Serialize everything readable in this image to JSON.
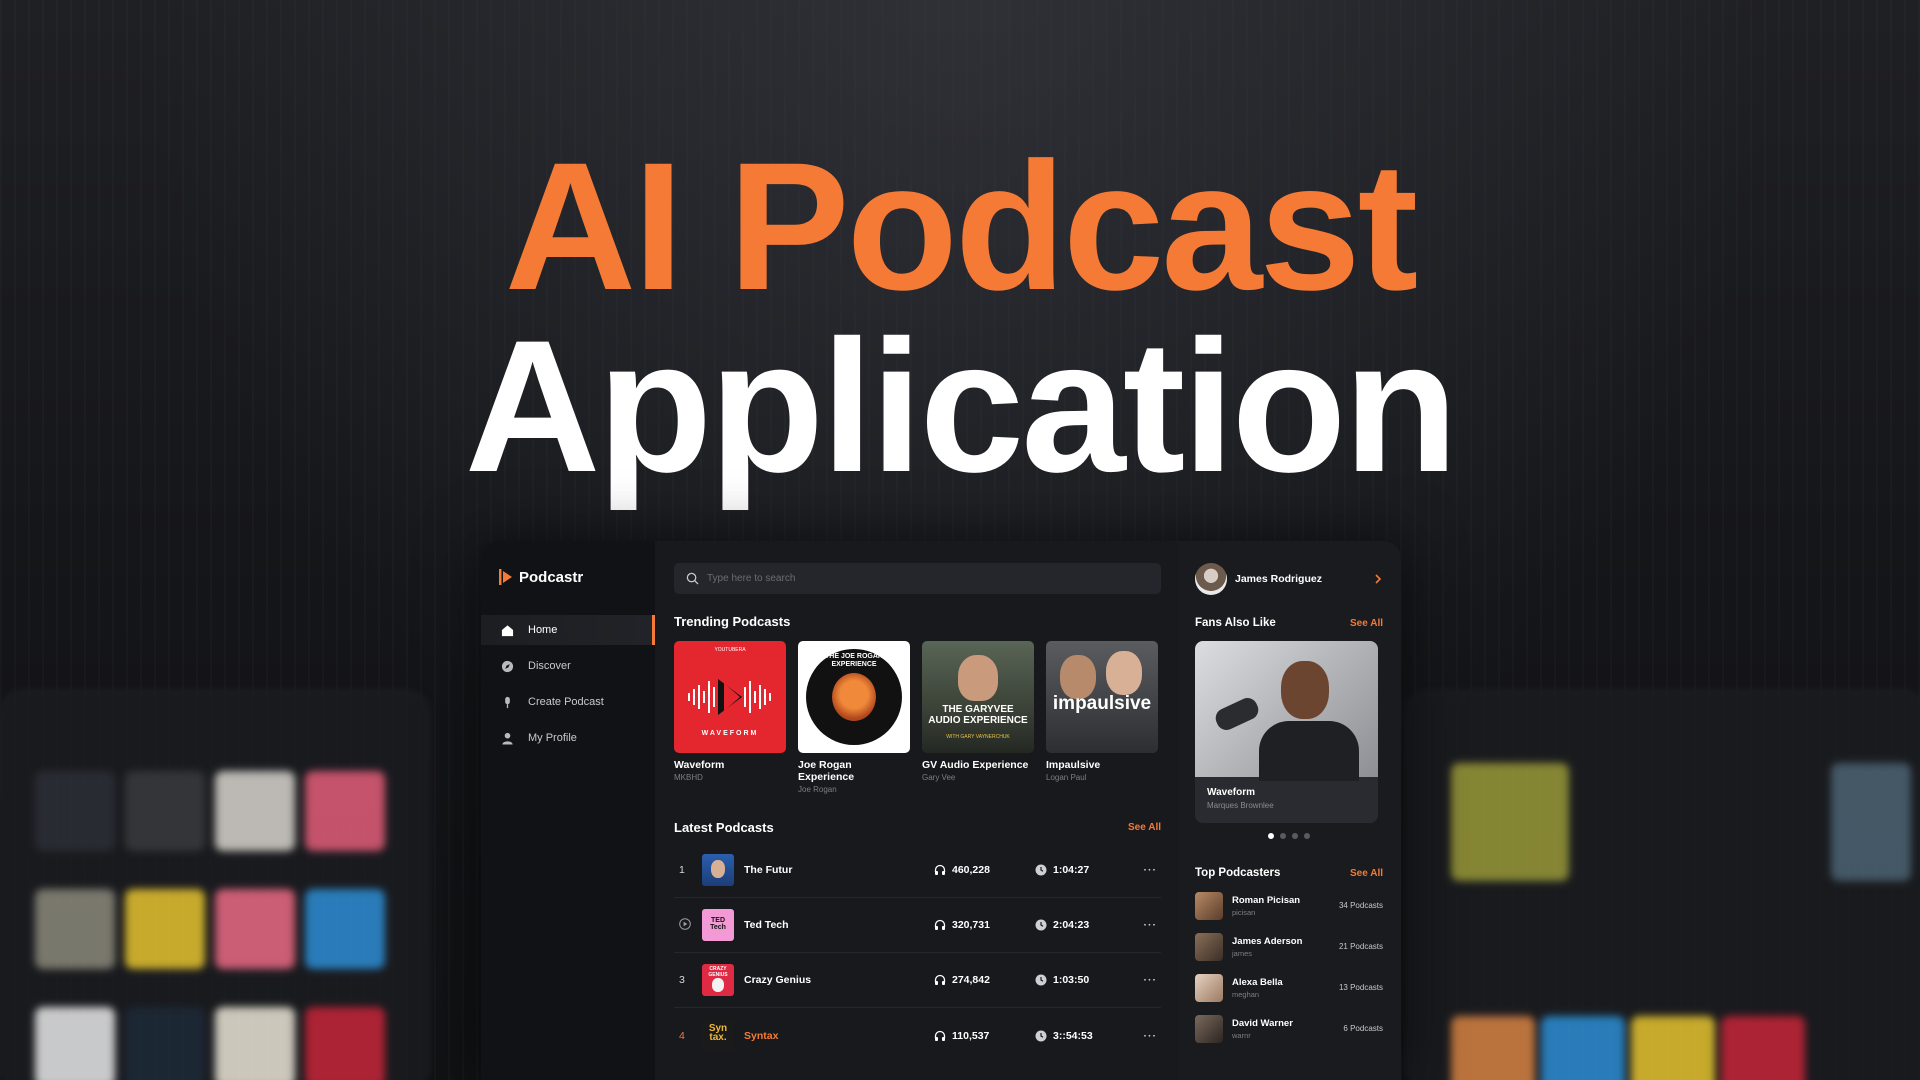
{
  "hero": {
    "line1": "AI Podcast",
    "line2": "Application"
  },
  "app": {
    "brand": "Podcastr",
    "nav": [
      {
        "label": "Home",
        "icon": "home-icon",
        "active": true
      },
      {
        "label": "Discover",
        "icon": "compass-icon",
        "active": false
      },
      {
        "label": "Create Podcast",
        "icon": "microphone-icon",
        "active": false
      },
      {
        "label": "My Profile",
        "icon": "user-icon",
        "active": false
      }
    ],
    "search": {
      "placeholder": "Type here to search"
    },
    "trending": {
      "title": "Trending Podcasts",
      "items": [
        {
          "title": "Waveform",
          "author": "MKBHD",
          "cover_text": "WAVEFORM",
          "cover_top": "YOUTUBERA"
        },
        {
          "title": "Joe Rogan Experience",
          "author": "Joe Rogan",
          "cover_text": "THE JOE ROGAN EXPERIENCE"
        },
        {
          "title": "GV Audio Experience",
          "author": "Gary Vee",
          "cover_text": "THE GARYVEE AUDIO EXPERIENCE",
          "cover_sub": "WITH GARY VAYNERCHUK"
        },
        {
          "title": "Impaulsive",
          "author": "Logan Paul",
          "cover_text": "impaulsive"
        }
      ]
    },
    "latest": {
      "title": "Latest Podcasts",
      "see_all": "See All",
      "rows": [
        {
          "num": "1",
          "name": "The Futur",
          "listeners": "460,228",
          "duration": "1:04:27",
          "more": "···"
        },
        {
          "num": "",
          "name": "Ted Tech",
          "listeners": "320,731",
          "duration": "2:04:23",
          "more": "···",
          "playing_icon": "play-circle-icon",
          "thumb_text": "TED Tech"
        },
        {
          "num": "3",
          "name": "Crazy Genius",
          "listeners": "274,842",
          "duration": "1:03:50",
          "more": "···",
          "thumb_text": "CRAZY GENIUS"
        },
        {
          "num": "4",
          "name": "Syntax",
          "listeners": "110,537",
          "duration": "3::54:53",
          "more": "···",
          "thumb_text": "Syn tax."
        }
      ]
    },
    "user": {
      "name": "James Rodriguez"
    },
    "fans": {
      "title": "Fans Also Like",
      "see_all": "See All",
      "card": {
        "title": "Waveform",
        "author": "Marques Brownlee"
      }
    },
    "top_podcasters": {
      "title": "Top Podcasters",
      "see_all": "See All",
      "items": [
        {
          "name": "Roman Picisan",
          "handle": "picisan",
          "count": "34 Podcasts"
        },
        {
          "name": "James Aderson",
          "handle": "james",
          "count": "21 Podcasts"
        },
        {
          "name": "Alexa Bella",
          "handle": "meghan",
          "count": "13 Podcasts"
        },
        {
          "name": "David Warner",
          "handle": "warnr",
          "count": "6 Podcasts"
        }
      ]
    }
  },
  "colors": {
    "accent": "#f47a35",
    "bg": "#151619",
    "panel": "#18191d"
  }
}
